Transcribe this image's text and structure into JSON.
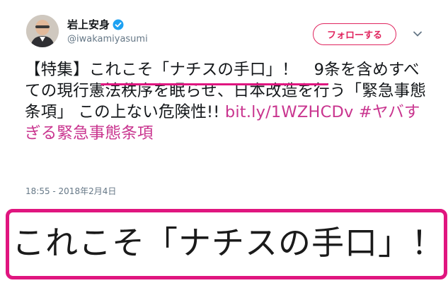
{
  "tweet": {
    "display_name": "岩上安身",
    "handle": "@iwakamiyasumi",
    "follow_label": "フォローする",
    "text_prefix": "【特集】",
    "text_highlight": "これこそ「ナチスの手口」",
    "text_body": "！　9条を含めすべての現行憲法秩序を眠らせ、日本改造を行う「緊急事態条項」 この上ない危険性!! ",
    "link": "bit.ly/1WZHCDv",
    "hashtag": "#ヤバすぎる緊急事態条項",
    "timestamp": "18:55 - 2018年2月4日"
  },
  "zoom": {
    "text": "これこそ「ナチスの手口」！"
  },
  "colors": {
    "accent": "#e0245e",
    "highlight_mark": "#e0157f",
    "link": "#c9358f",
    "verified": "#1da1f2",
    "secondary_text": "#657786"
  },
  "icons": {
    "verified": "verified-badge-icon",
    "menu": "chevron-down-icon"
  }
}
